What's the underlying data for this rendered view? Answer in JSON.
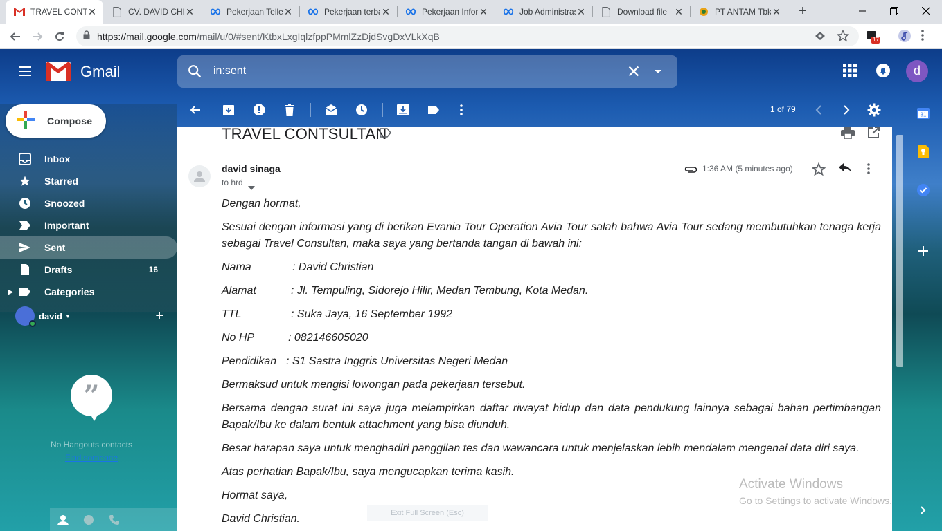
{
  "browser": {
    "tabs": [
      {
        "title": "TRAVEL CONTSULTAN",
        "favicon": "gmail-icon",
        "active": true
      },
      {
        "title": "CV. DAVID CHRISTIAN",
        "favicon": "document-icon"
      },
      {
        "title": "Pekerjaan Teller",
        "favicon": "infinity-icon"
      },
      {
        "title": "Pekerjaan terbaru",
        "favicon": "infinity-icon"
      },
      {
        "title": "Pekerjaan Informasi",
        "favicon": "infinity-icon"
      },
      {
        "title": "Job Administrasi",
        "favicon": "infinity-icon"
      },
      {
        "title": "Download file",
        "favicon": "document-icon"
      },
      {
        "title": "PT ANTAM Tbk",
        "favicon": "antam-icon"
      }
    ],
    "url_host": "https://mail.google.com",
    "url_path": "/mail/u/0/#sent/KtbxLxgIqlzfppPMmlZzDjdSvgDxVLkXqB",
    "extension_badge": "17"
  },
  "gmail": {
    "brand": "Gmail",
    "search_value": "in:sent",
    "avatar_letter": "d",
    "compose_label": "Compose",
    "nav": [
      {
        "label": "Inbox",
        "icon": "inbox-icon",
        "count": ""
      },
      {
        "label": "Starred",
        "icon": "star-icon",
        "count": ""
      },
      {
        "label": "Snoozed",
        "icon": "clock-icon",
        "count": ""
      },
      {
        "label": "Important",
        "icon": "important-icon",
        "count": ""
      },
      {
        "label": "Sent",
        "icon": "send-icon",
        "count": "",
        "active": true
      },
      {
        "label": "Drafts",
        "icon": "draft-icon",
        "count": "16"
      },
      {
        "label": "Categories",
        "icon": "label-icon",
        "count": ""
      }
    ],
    "account_name": "david",
    "hangouts_empty": "No Hangouts contacts",
    "hangouts_find": "Find someone",
    "pager": "1 of 79"
  },
  "message": {
    "subject": "TRAVEL CONTSULTAN",
    "sender": "david sinaga",
    "to_line": "to hrd",
    "time": "1:36 AM (5 minutes ago)",
    "body": {
      "greeting": "Dengan hormat,",
      "intro": "Sesuai dengan informasi yang di berikan Evania Tour Operation Avia Tour salah bahwa Avia Tour sedang membutuhkan tenaga kerja sebagai Travel Consultan, maka saya yang bertanda tangan di bawah ini:",
      "fields": [
        {
          "key": "Nama",
          "value": ": David Christian"
        },
        {
          "key": "Alamat",
          "value": ": Jl. Tempuling, Sidorejo Hilir, Medan Tembung, Kota Medan."
        },
        {
          "key": "TTL",
          "value": ": Suka Jaya, 16 September 1992"
        },
        {
          "key": "No HP",
          "value": ": 082146605020"
        },
        {
          "key": "Pendidikan",
          "value": ": S1 Sastra Inggris Universitas Negeri Medan"
        }
      ],
      "purpose": "Bermaksud untuk mengisi lowongan pada pekerjaan tersebut.",
      "attachment_note": "Bersama dengan surat ini saya juga melampirkan daftar riwayat hidup dan data pendukung lainnya sebagai bahan pertimbangan Bapak/Ibu ke dalam bentuk attachment yang bisa diunduh.",
      "hope": "Besar harapan saya untuk menghadiri panggilan tes dan wawancara untuk menjelaskan lebih mendalam mengenai data diri saya.",
      "thanks": "Atas perhatian Bapak/Ibu, saya mengucapkan terima kasih.",
      "closing": "Hormat saya,",
      "signature": "David Christian."
    }
  },
  "overlay": {
    "activate_title": "Activate Windows",
    "activate_sub": "Go to Settings to activate Windows.",
    "fullscreen_hint": "Exit Full Screen (Esc)"
  }
}
